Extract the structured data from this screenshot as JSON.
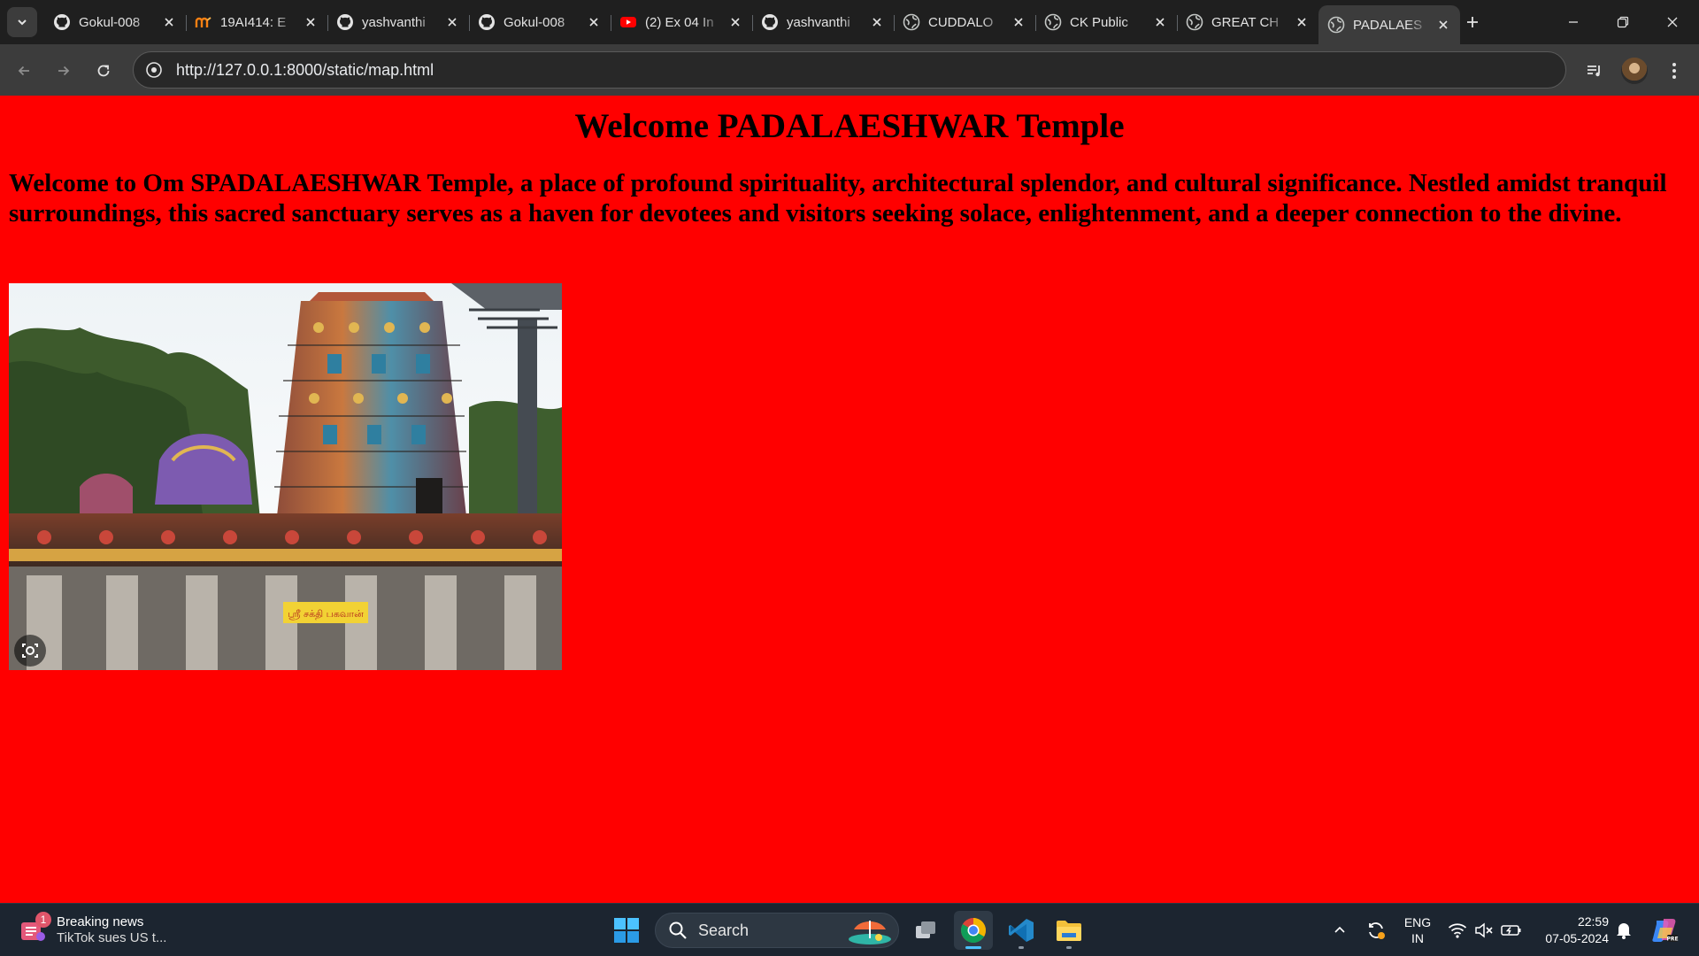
{
  "browser": {
    "tabs": [
      {
        "title": "Gokul-008",
        "icon": "github-icon"
      },
      {
        "title": "19AI414: E",
        "icon": "moodle-icon"
      },
      {
        "title": "yashvanthi",
        "icon": "github-icon"
      },
      {
        "title": "Gokul-008",
        "icon": "github-icon"
      },
      {
        "title": "(2) Ex 04 In",
        "icon": "youtube-icon"
      },
      {
        "title": "yashvanthi",
        "icon": "github-icon"
      },
      {
        "title": "CUDDALO",
        "icon": "globe-icon"
      },
      {
        "title": "CK Public",
        "icon": "globe-icon"
      },
      {
        "title": "GREAT CH",
        "icon": "globe-icon"
      },
      {
        "title": "PADALAES",
        "icon": "globe-icon",
        "active": true
      }
    ],
    "address": "http://127.0.0.1:8000/static/map.html"
  },
  "page": {
    "heading": "Welcome PADALAESHWAR Temple",
    "intro": "Welcome to Om SPADALAESHWAR Temple, a place of profound spirituality, architectural splendor, and cultural significance. Nestled amidst tranquil surroundings, this sacred sanctuary serves as a haven for devotees and visitors seeking solace, enlightenment, and a deeper connection to the divine.",
    "image_sign_text": "ஸ்ரீ சக்தி பகவான்",
    "background_color": "#ff0000"
  },
  "taskbar": {
    "news_title": "Breaking news",
    "news_sub": "TikTok sues US t...",
    "news_badge": "1",
    "search_label": "Search",
    "lang_top": "ENG",
    "lang_bottom": "IN",
    "time": "22:59",
    "date": "07-05-2024"
  }
}
